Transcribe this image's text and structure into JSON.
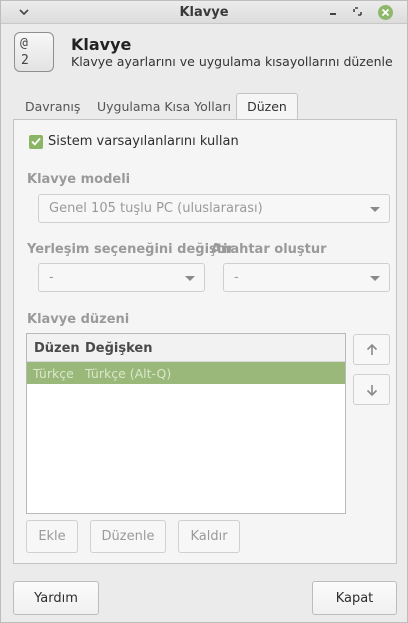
{
  "window": {
    "title": "Klavye"
  },
  "header": {
    "title": "Klavye",
    "subtitle": "Klavye ayarlarını ve uygulama kısayollarını düzenle",
    "icon_keys": [
      "@",
      "2"
    ]
  },
  "tabs": [
    {
      "label": "Davranış",
      "active": false
    },
    {
      "label": "Uygulama Kısa Yolları",
      "active": false
    },
    {
      "label": "Düzen",
      "active": true
    }
  ],
  "layout_tab": {
    "use_system_defaults": {
      "label": "Sistem varsayılanlarını kullan",
      "checked": true
    },
    "keyboard_model": {
      "label": "Klavye modeli",
      "value": "Genel 105 tuşlu PC (uluslararası)"
    },
    "switch_layout": {
      "label": "Yerleşim seçeneğini değiştir",
      "value": "-"
    },
    "compose_key": {
      "label": "Anahtar oluştur",
      "value": "-"
    },
    "layouts": {
      "label": "Klavye düzeni",
      "columns": [
        "Düzen",
        "Değişken"
      ],
      "rows": [
        {
          "layout": "Türkçe",
          "variant": "Türkçe (Alt-Q)",
          "selected": true
        }
      ]
    },
    "buttons": {
      "add": "Ekle",
      "edit": "Düzenle",
      "remove": "Kaldır"
    }
  },
  "footer": {
    "help": "Yardım",
    "close": "Kapat"
  },
  "colors": {
    "accent": "#8ab564",
    "selected_row": "#9ab87a"
  }
}
